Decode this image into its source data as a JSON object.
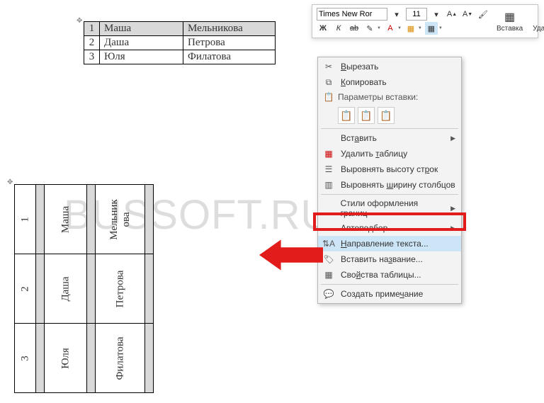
{
  "toolbar": {
    "font_name": "Times New Ror",
    "font_size": "11",
    "insert_label": "Вставка",
    "delete_label": "Удаление",
    "bold": "Ж",
    "italic": "К"
  },
  "tables": {
    "rows": [
      {
        "n": "1",
        "first": "Маша",
        "last": "Мельникова"
      },
      {
        "n": "2",
        "first": "Даша",
        "last": "Петрова"
      },
      {
        "n": "3",
        "first": "Юля",
        "last": "Филатова"
      }
    ]
  },
  "vtable_surname_wrap": "Мельник\nова",
  "context_menu": {
    "cut": "Вырезать",
    "copy": "Копировать",
    "paste_header": "Параметры вставки:",
    "insert": "Вставить",
    "delete_table": "Удалить таблицу",
    "dist_rows": "Выровнять высоту строк",
    "dist_cols": "Выровнять ширину столбцов",
    "border_styles": "Стили оформления границ",
    "autofit": "Автоподбор",
    "text_direction": "Направление текста...",
    "insert_caption": "Вставить название...",
    "table_props": "Свойства таблицы...",
    "new_comment": "Создать примечание"
  },
  "watermark": "BUSSOFT.RU"
}
